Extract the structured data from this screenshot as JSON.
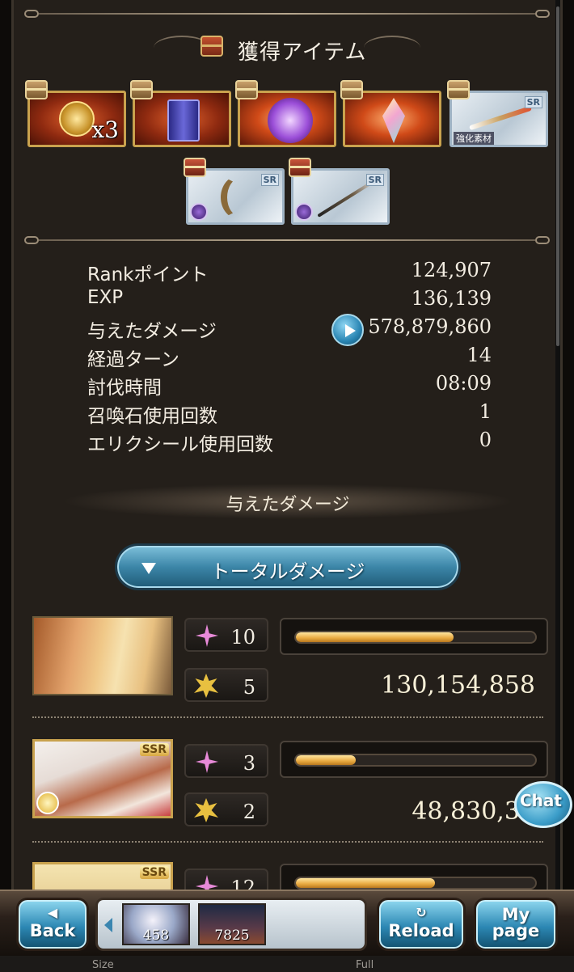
{
  "header": {
    "title": "獲得アイテム"
  },
  "items": [
    {
      "name": "gold-medal",
      "count": "x3"
    },
    {
      "name": "blue-tome"
    },
    {
      "name": "purple-orb"
    },
    {
      "name": "prism-crystal"
    },
    {
      "name": "flame-blade",
      "rarity": "SR",
      "tag": "強化素材"
    },
    {
      "name": "crescent-blade",
      "rarity": "SR"
    },
    {
      "name": "spear",
      "rarity": "SR"
    }
  ],
  "stats": [
    {
      "label": "Rankポイント",
      "value": "124,907"
    },
    {
      "label": "EXP",
      "value": "136,139"
    },
    {
      "label": "与えたダメージ",
      "value": "578,879,860"
    },
    {
      "label": "経過ターン",
      "value": "14"
    },
    {
      "label": "討伐時間",
      "value": "08:09"
    },
    {
      "label": "召喚石使用回数",
      "value": "1"
    },
    {
      "label": "エリクシール使用回数",
      "value": "0"
    }
  ],
  "damage_section": {
    "title": "与えたダメージ",
    "toggle_label": "トータルダメージ"
  },
  "characters": [
    {
      "sparkle": "10",
      "burst": "5",
      "damage": "130,154,858",
      "gauge": 0.66,
      "ssr": ""
    },
    {
      "sparkle": "3",
      "burst": "2",
      "damage": "48,830,34",
      "gauge": 0.25,
      "ssr": "SSR"
    },
    {
      "sparkle": "12",
      "gauge": 0.58,
      "ssr": "SSR"
    }
  ],
  "chat": {
    "label": "Chat"
  },
  "nav": {
    "back": "Back",
    "reload": "Reload",
    "mypage_line1": "My",
    "mypage_line2": "page",
    "thumbs": [
      "458",
      "7825"
    ]
  },
  "footer": {
    "size": "Size",
    "full": "Full"
  },
  "colors": {
    "accent": "#3a9cc8",
    "gauge": "#e8a940",
    "panel": "#241f1a"
  }
}
